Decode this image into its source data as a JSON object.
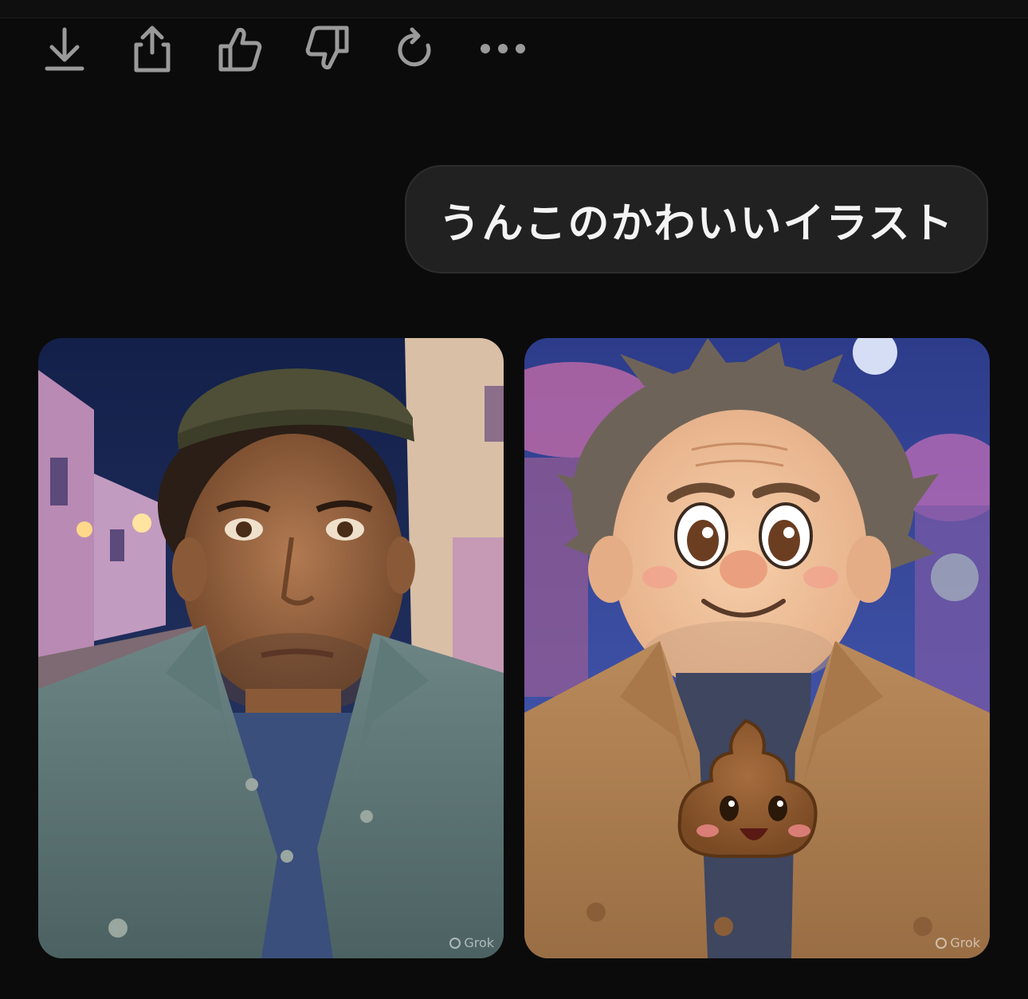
{
  "toolbar": {
    "actions": [
      {
        "name": "download-icon"
      },
      {
        "name": "share-icon"
      },
      {
        "name": "thumbs-up-icon"
      },
      {
        "name": "thumbs-down-icon"
      },
      {
        "name": "regenerate-icon"
      },
      {
        "name": "more-options-icon"
      }
    ]
  },
  "user_message": {
    "text": "うんこのかわいいイラスト"
  },
  "images": [
    {
      "watermark": "Grok"
    },
    {
      "watermark": "Grok"
    }
  ],
  "colors": {
    "background": "#0b0b0b",
    "bubble_bg": "#212121",
    "icon": "#9a9a9a"
  }
}
